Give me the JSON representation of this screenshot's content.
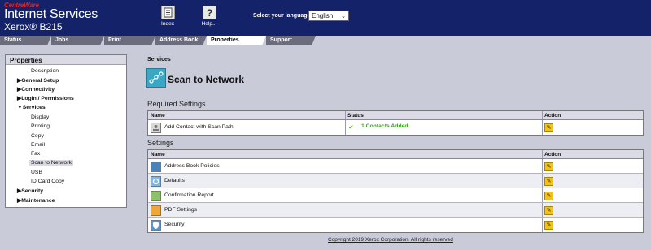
{
  "header": {
    "brand_small": "CentreWare",
    "brand_main": "Internet Services",
    "model": "Xerox® B215",
    "buttons": [
      {
        "label": "Index",
        "icon": "index-icon"
      },
      {
        "label": "Help...",
        "icon": "help-icon"
      }
    ],
    "language_label": "Select your language :",
    "language_value": "English"
  },
  "tabs": [
    "Status",
    "Jobs",
    "Print",
    "Address Book",
    "Properties",
    "Support"
  ],
  "active_tab": "Properties",
  "sidebar": {
    "title": "Properties",
    "items": [
      {
        "label": "Description",
        "level": 1,
        "bold": false
      },
      {
        "label": "▶General Setup",
        "level": 0,
        "bold": true
      },
      {
        "label": "▶Connectivity",
        "level": 0,
        "bold": true
      },
      {
        "label": "▶Login / Permissions",
        "level": 0,
        "bold": true
      },
      {
        "label": "▼Services",
        "level": 0,
        "bold": true
      },
      {
        "label": "Display",
        "level": 1,
        "bold": false
      },
      {
        "label": "Printing",
        "level": 1,
        "bold": false
      },
      {
        "label": "Copy",
        "level": 1,
        "bold": false
      },
      {
        "label": "Email",
        "level": 1,
        "bold": false
      },
      {
        "label": "Fax",
        "level": 1,
        "bold": false
      },
      {
        "label": "Scan to Network",
        "level": 1,
        "bold": false,
        "selected": true
      },
      {
        "label": "USB",
        "level": 1,
        "bold": false
      },
      {
        "label": "ID Card Copy",
        "level": 1,
        "bold": false
      },
      {
        "label": "▶Security",
        "level": 0,
        "bold": true
      },
      {
        "label": "▶Maintenance",
        "level": 0,
        "bold": true
      }
    ]
  },
  "main": {
    "breadcrumb": "Services",
    "title": "Scan to Network",
    "required": {
      "heading": "Required Settings",
      "headers": [
        "Name",
        "Status",
        "Action"
      ],
      "rows": [
        {
          "name": "Add Contact with Scan Path",
          "status": "1 Contacts Added",
          "icon": "contact-icon"
        }
      ]
    },
    "settings": {
      "heading": "Settings",
      "headers": [
        "Name",
        "Action"
      ],
      "rows": [
        {
          "name": "Address Book Policies",
          "icon": "address-book-icon"
        },
        {
          "name": "Defaults",
          "icon": "defaults-icon"
        },
        {
          "name": "Confirmation Report",
          "icon": "report-icon"
        },
        {
          "name": "PDF Settings",
          "icon": "pdf-icon"
        },
        {
          "name": "Security",
          "icon": "shield-icon"
        }
      ]
    }
  },
  "footer": "Copyright 2019 Xerox Corporation. All rights reserved"
}
